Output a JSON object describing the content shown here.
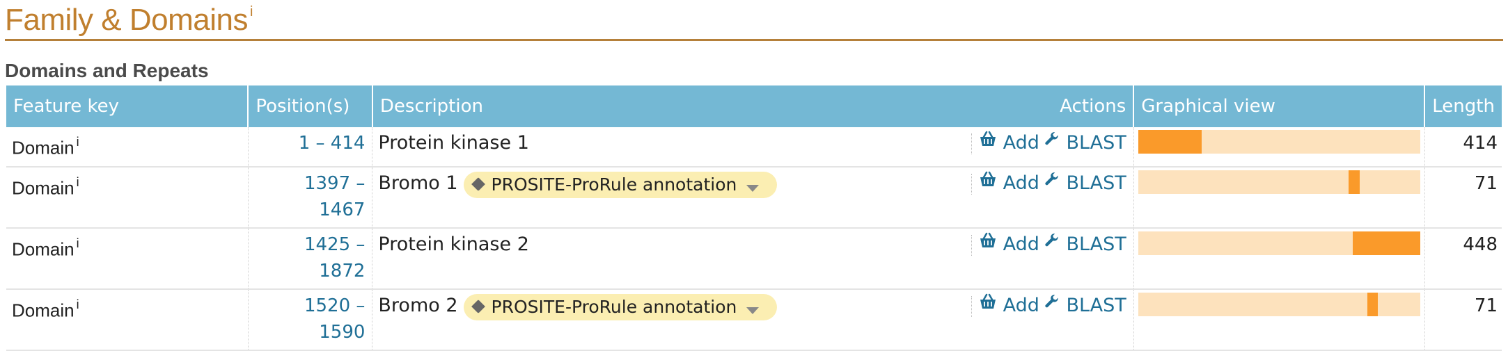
{
  "section": {
    "title": "Family & Domains",
    "info_marker": "i"
  },
  "subsection": {
    "title": "Domains and Repeats"
  },
  "table": {
    "headers": {
      "feature_key": "Feature key",
      "positions": "Position(s)",
      "description": "Description",
      "actions": "Actions",
      "graphical_view": "Graphical view",
      "length": "Length"
    },
    "rows": [
      {
        "feature_key": "Domain",
        "info": "i",
        "position_line1": "1 – 414",
        "position_line2": "",
        "description": "Protein kinase 1",
        "annotation": "",
        "add_label": "Add",
        "blast_label": "BLAST",
        "length": "414",
        "bar_start_fraction": 0.0,
        "bar_fraction": 0.226
      },
      {
        "feature_key": "Domain",
        "info": "i",
        "position_line1": "1397 –",
        "position_line2": "1467",
        "description": "Bromo 1",
        "annotation": "PROSITE-ProRule annotation",
        "add_label": "Add",
        "blast_label": "BLAST",
        "length": "71",
        "bar_start_fraction": 0.746,
        "bar_fraction": 0.039
      },
      {
        "feature_key": "Domain",
        "info": "i",
        "position_line1": "1425 –",
        "position_line2": "1872",
        "description": "Protein kinase 2",
        "annotation": "",
        "add_label": "Add",
        "blast_label": "BLAST",
        "length": "448",
        "bar_start_fraction": 0.762,
        "bar_fraction": 0.238
      },
      {
        "feature_key": "Domain",
        "info": "i",
        "position_line1": "1520 –",
        "position_line2": "1590",
        "description": "Bromo 2",
        "annotation": "PROSITE-ProRule annotation",
        "add_label": "Add",
        "blast_label": "BLAST",
        "length": "71",
        "bar_start_fraction": 0.812,
        "bar_fraction": 0.039
      }
    ]
  },
  "colors": {
    "title_orange": "#c07f2e",
    "header_blue": "#74b8d4",
    "link_blue": "#1f6f96",
    "bar_track": "#fde2bd",
    "bar_fill": "#fa9a2a",
    "annotation_bg": "#fbeeb2"
  },
  "icons": {
    "add": "basket-icon",
    "blast": "wrench-icon",
    "annotation": "tag-icon",
    "dropdown": "chevron-down-icon"
  }
}
